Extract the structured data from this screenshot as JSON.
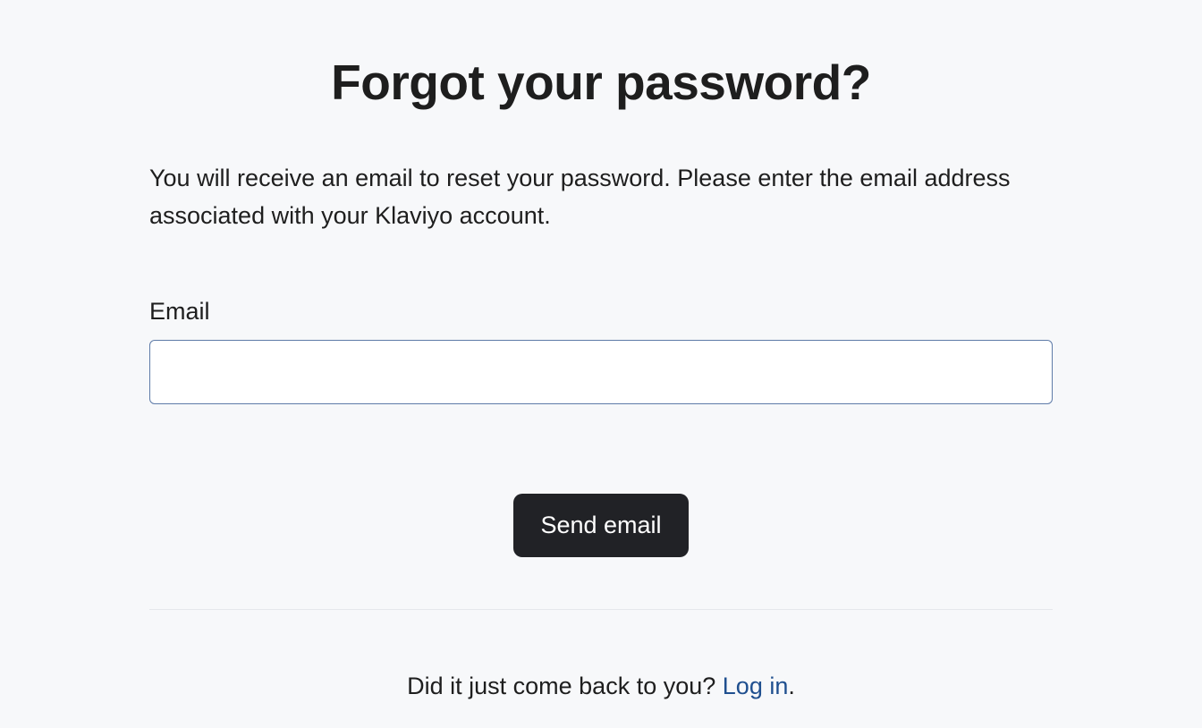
{
  "header": {
    "title": "Forgot your password?"
  },
  "main": {
    "description": "You will receive an email to reset your password. Please enter the email address associated with your Klaviyo account.",
    "email_label": "Email",
    "email_value": "",
    "submit_label": "Send email"
  },
  "footer": {
    "prompt": "Did it just come back to you? ",
    "login_link": "Log in",
    "suffix": "."
  }
}
